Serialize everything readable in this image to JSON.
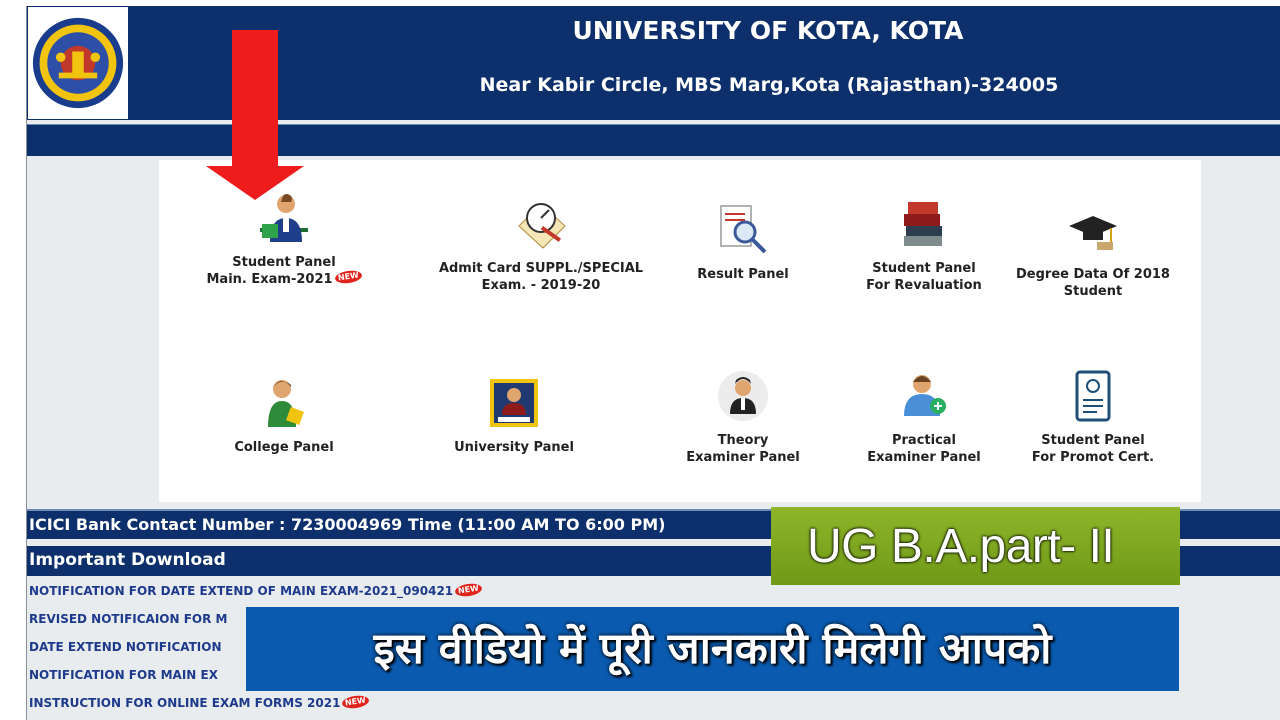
{
  "header": {
    "title": "UNIVERSITY OF KOTA, KOTA",
    "address": "Near Kabir Circle, MBS Marg,Kota (Rajasthan)-324005",
    "logo_icon": "university-seal-icon"
  },
  "panels": [
    {
      "id": "student-main",
      "line1": "Student Panel",
      "line2": "Main. Exam-2021",
      "icon": "student-icon",
      "new": "NEW"
    },
    {
      "id": "admit-card",
      "line1": "Admit Card SUPPL./SPECIAL",
      "line2": "Exam. - 2019-20",
      "icon": "pen-paper-icon"
    },
    {
      "id": "result",
      "line1": "Result Panel",
      "line2": "",
      "icon": "magnifier-document-icon"
    },
    {
      "id": "revaluation",
      "line1": "Student Panel",
      "line2": "For Revaluation",
      "icon": "books-icon"
    },
    {
      "id": "degree-data",
      "line1": "Degree Data Of 2018 Student",
      "line2": "",
      "icon": "graduation-cap-icon"
    },
    {
      "id": "college",
      "line1": "College Panel",
      "line2": "",
      "icon": "teacher-icon"
    },
    {
      "id": "university",
      "line1": "University Panel",
      "line2": "",
      "icon": "admin-login-icon"
    },
    {
      "id": "theory-examiner",
      "line1": "Theory",
      "line2": "Examiner Panel",
      "icon": "examiner-icon"
    },
    {
      "id": "practical-examiner",
      "line1": "Practical",
      "line2": "Examiner Panel",
      "icon": "user-add-icon"
    },
    {
      "id": "promot-cert",
      "line1": "Student Panel",
      "line2": "For Promot Cert.",
      "icon": "certificate-scroll-icon"
    }
  ],
  "info_bar": "ICICI Bank Contact Number : 7230004969 Time (11:00 AM TO 6:00 PM)",
  "downloads_title": "Important Download",
  "downloads": [
    {
      "text": "NOTIFICATION FOR DATE EXTEND OF MAIN EXAM-2021_090421",
      "new": "NEW"
    },
    {
      "text": "REVISED NOTIFICAION FOR M",
      "new": ""
    },
    {
      "text": "DATE EXTEND NOTIFICATION",
      "new": ""
    },
    {
      "text": "NOTIFICATION FOR MAIN EX",
      "new": ""
    },
    {
      "text": "INSTRUCTION FOR ONLINE EXAM FORMS 2021",
      "new": "NEW"
    }
  ],
  "overlay": {
    "ug_banner": "UG B.A.part- II",
    "hindi_caption": "इस वीडियो में पूरी जानकारी मिलेगी आपको",
    "arrow_color": "#ee1c1c"
  },
  "colors": {
    "header_bg": "#0d2f6b",
    "link": "#1d3a8c",
    "new_badge": "#e0241b",
    "banner_green": "#7ea820",
    "caption_blue": "#0a5bb0"
  }
}
